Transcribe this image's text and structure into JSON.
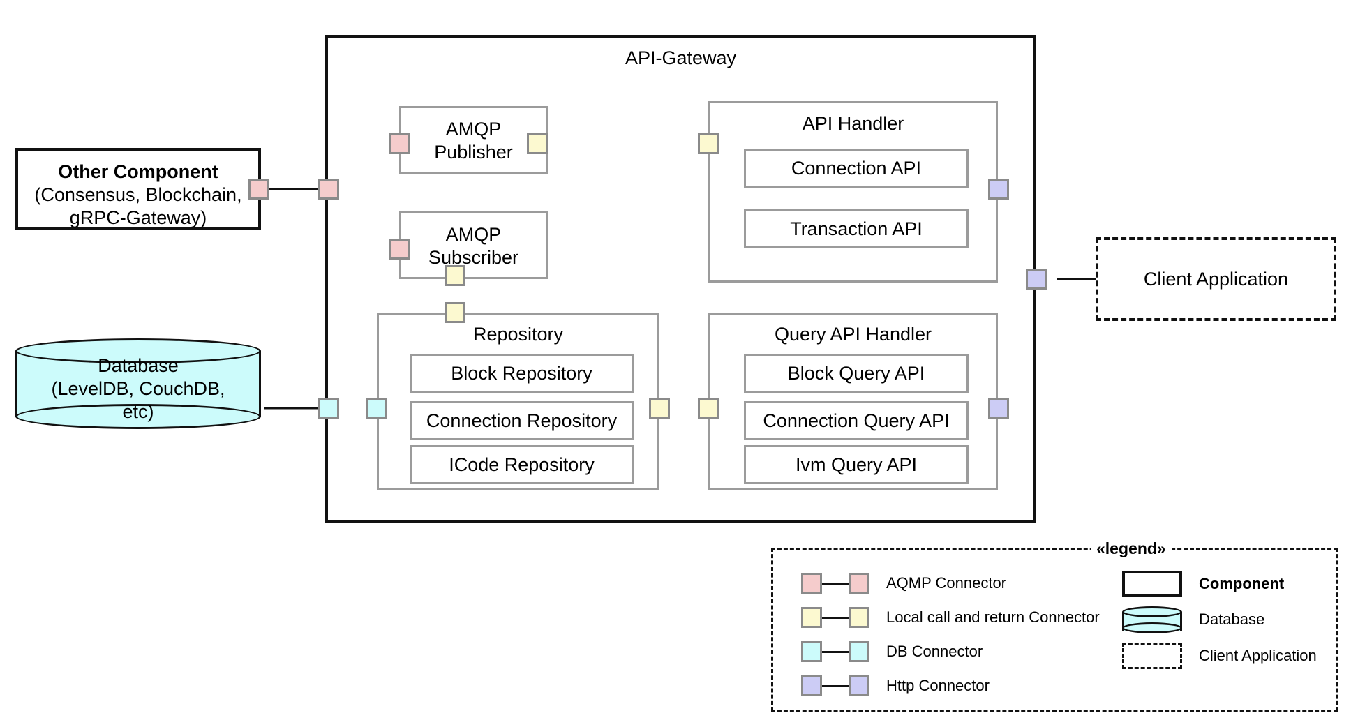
{
  "gateway": {
    "title": "API-Gateway"
  },
  "other_component": {
    "line1": "Other Component",
    "line2": "(Consensus, Blockchain,",
    "line3": "gRPC-Gateway)"
  },
  "database": {
    "line1": "Database",
    "line2": "(LevelDB, CouchDB,",
    "line3": "etc)"
  },
  "client_application": {
    "label": "Client Application"
  },
  "amqp_publisher": {
    "line1": "AMQP",
    "line2": "Publisher"
  },
  "amqp_subscriber": {
    "line1": "AMQP",
    "line2": "Subscriber"
  },
  "api_handler": {
    "title": "API Handler",
    "rows": [
      {
        "label": "Connection API"
      },
      {
        "label": "Transaction API"
      }
    ]
  },
  "repository": {
    "title": "Repository",
    "rows": [
      {
        "label": "Block Repository"
      },
      {
        "label": "Connection Repository"
      },
      {
        "label": "ICode Repository"
      }
    ]
  },
  "query_api_handler": {
    "title": "Query API Handler",
    "rows": [
      {
        "label": "Block Query API"
      },
      {
        "label": "Connection Query API"
      },
      {
        "label": "Ivm Query API"
      }
    ]
  },
  "legend": {
    "title": "«legend»",
    "connectors": [
      {
        "label": "AQMP Connector",
        "color": "#f5cccc"
      },
      {
        "label": "Local call and return Connector",
        "color": "#fcf9d0"
      },
      {
        "label": "DB Connector",
        "color": "#ccfbfb"
      },
      {
        "label": "Http Connector",
        "color": "#ccccf5"
      }
    ],
    "shapes": [
      {
        "label": "Component",
        "kind": "component"
      },
      {
        "label": "Database",
        "kind": "database"
      },
      {
        "label": "Client Application",
        "kind": "client"
      }
    ]
  },
  "colors": {
    "amqp": "#f5cccc",
    "local": "#fcf9d0",
    "db": "#ccfbfb",
    "http": "#ccccf5",
    "stroke_heavy": "#111111",
    "stroke_light": "#9b9b9b",
    "port_border": "#8a8a8a"
  }
}
